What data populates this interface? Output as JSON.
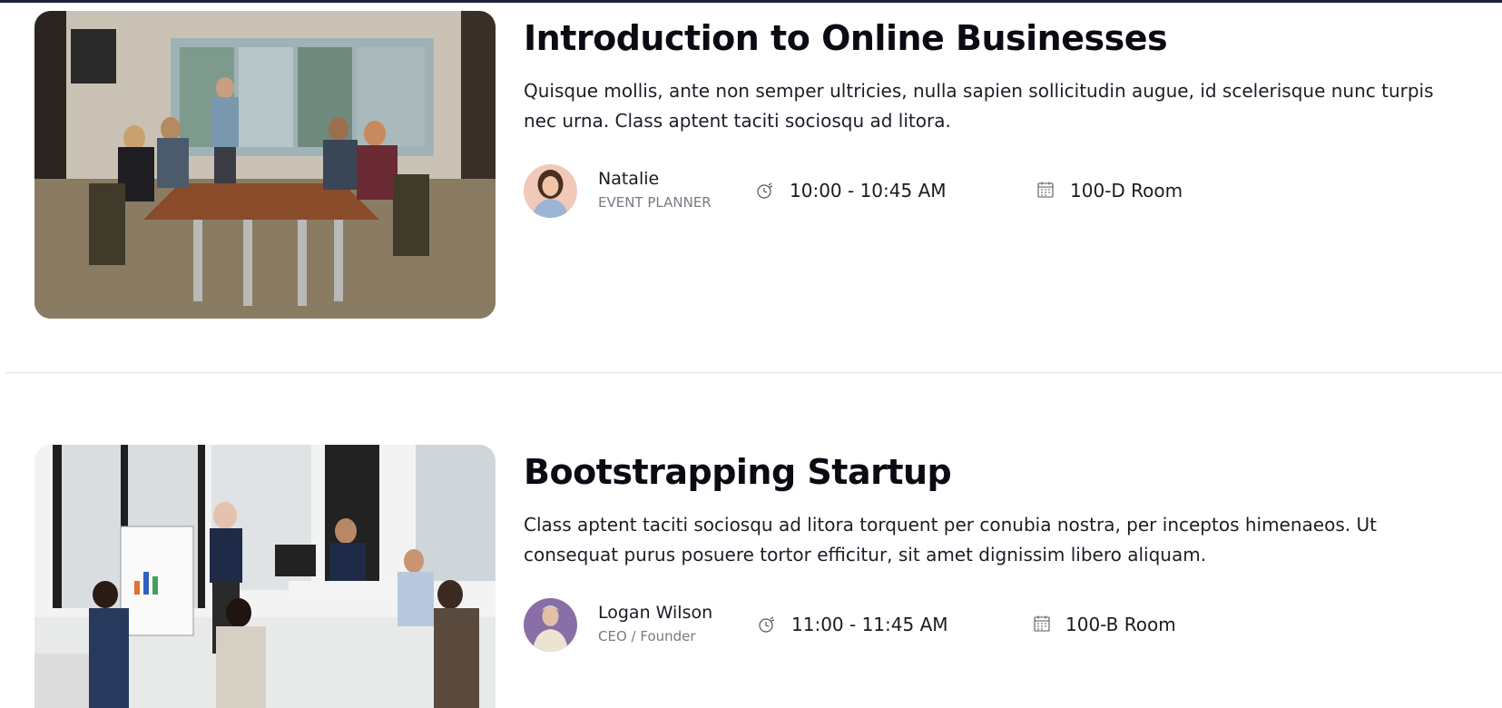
{
  "sessions": [
    {
      "title": "Introduction to Online Businesses",
      "description": "Quisque mollis, ante non semper ultricies, nulla sapien sollicitudin augue, id scelerisque nunc turpis nec urna. Class aptent taciti sociosqu ad litora.",
      "speaker": {
        "name": "Natalie",
        "role": "EVENT PLANNER"
      },
      "time": "10:00 - 10:45 AM",
      "room": "100-D Room",
      "icons": {
        "time": "clock-icon",
        "room": "calendar-icon"
      }
    },
    {
      "title": "Bootstrapping Startup",
      "description": "Class aptent taciti sociosqu ad litora torquent per conubia nostra, per inceptos himenaeos. Ut consequat purus posuere tortor efficitur, sit amet dignissim libero aliquam.",
      "speaker": {
        "name": "Logan Wilson",
        "role": "CEO / Founder"
      },
      "time": "11:00 - 11:45 AM",
      "room": "100-B Room",
      "icons": {
        "time": "clock-icon",
        "room": "calendar-icon"
      }
    }
  ],
  "colors": {
    "top_bar": "#1e2140",
    "title": "#0b0b14",
    "role": "#7a7a84",
    "divider": "#e4e4e8"
  }
}
